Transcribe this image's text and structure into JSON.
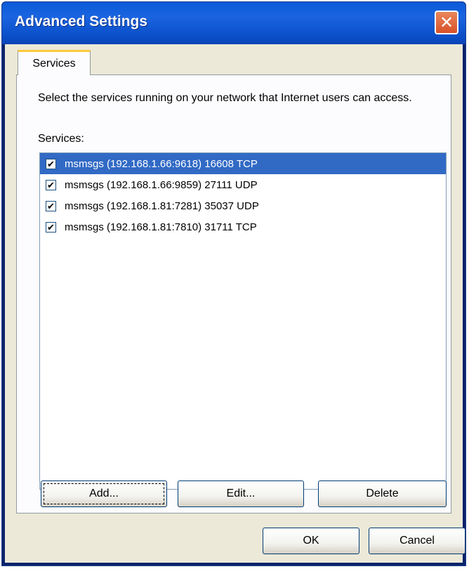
{
  "window": {
    "title": "Advanced Settings"
  },
  "tabs": [
    {
      "label": "Services"
    }
  ],
  "panel": {
    "description": "Select the services running on your network that Internet users can access.",
    "services_label": "Services:",
    "services": [
      {
        "text": "msmsgs (192.168.1.66:9618) 16608 TCP",
        "checked": true,
        "selected": true
      },
      {
        "text": "msmsgs (192.168.1.66:9859) 27111 UDP",
        "checked": true,
        "selected": false
      },
      {
        "text": "msmsgs (192.168.1.81:7281) 35037 UDP",
        "checked": true,
        "selected": false
      },
      {
        "text": "msmsgs (192.168.1.81:7810) 31711 TCP",
        "checked": true,
        "selected": false
      }
    ],
    "buttons": {
      "add": "Add...",
      "edit": "Edit...",
      "delete": "Delete"
    }
  },
  "footer": {
    "ok": "OK",
    "cancel": "Cancel"
  },
  "colors": {
    "selection": "#316ac5",
    "titlebar": "#0a5ad8",
    "close": "#d8522a"
  }
}
